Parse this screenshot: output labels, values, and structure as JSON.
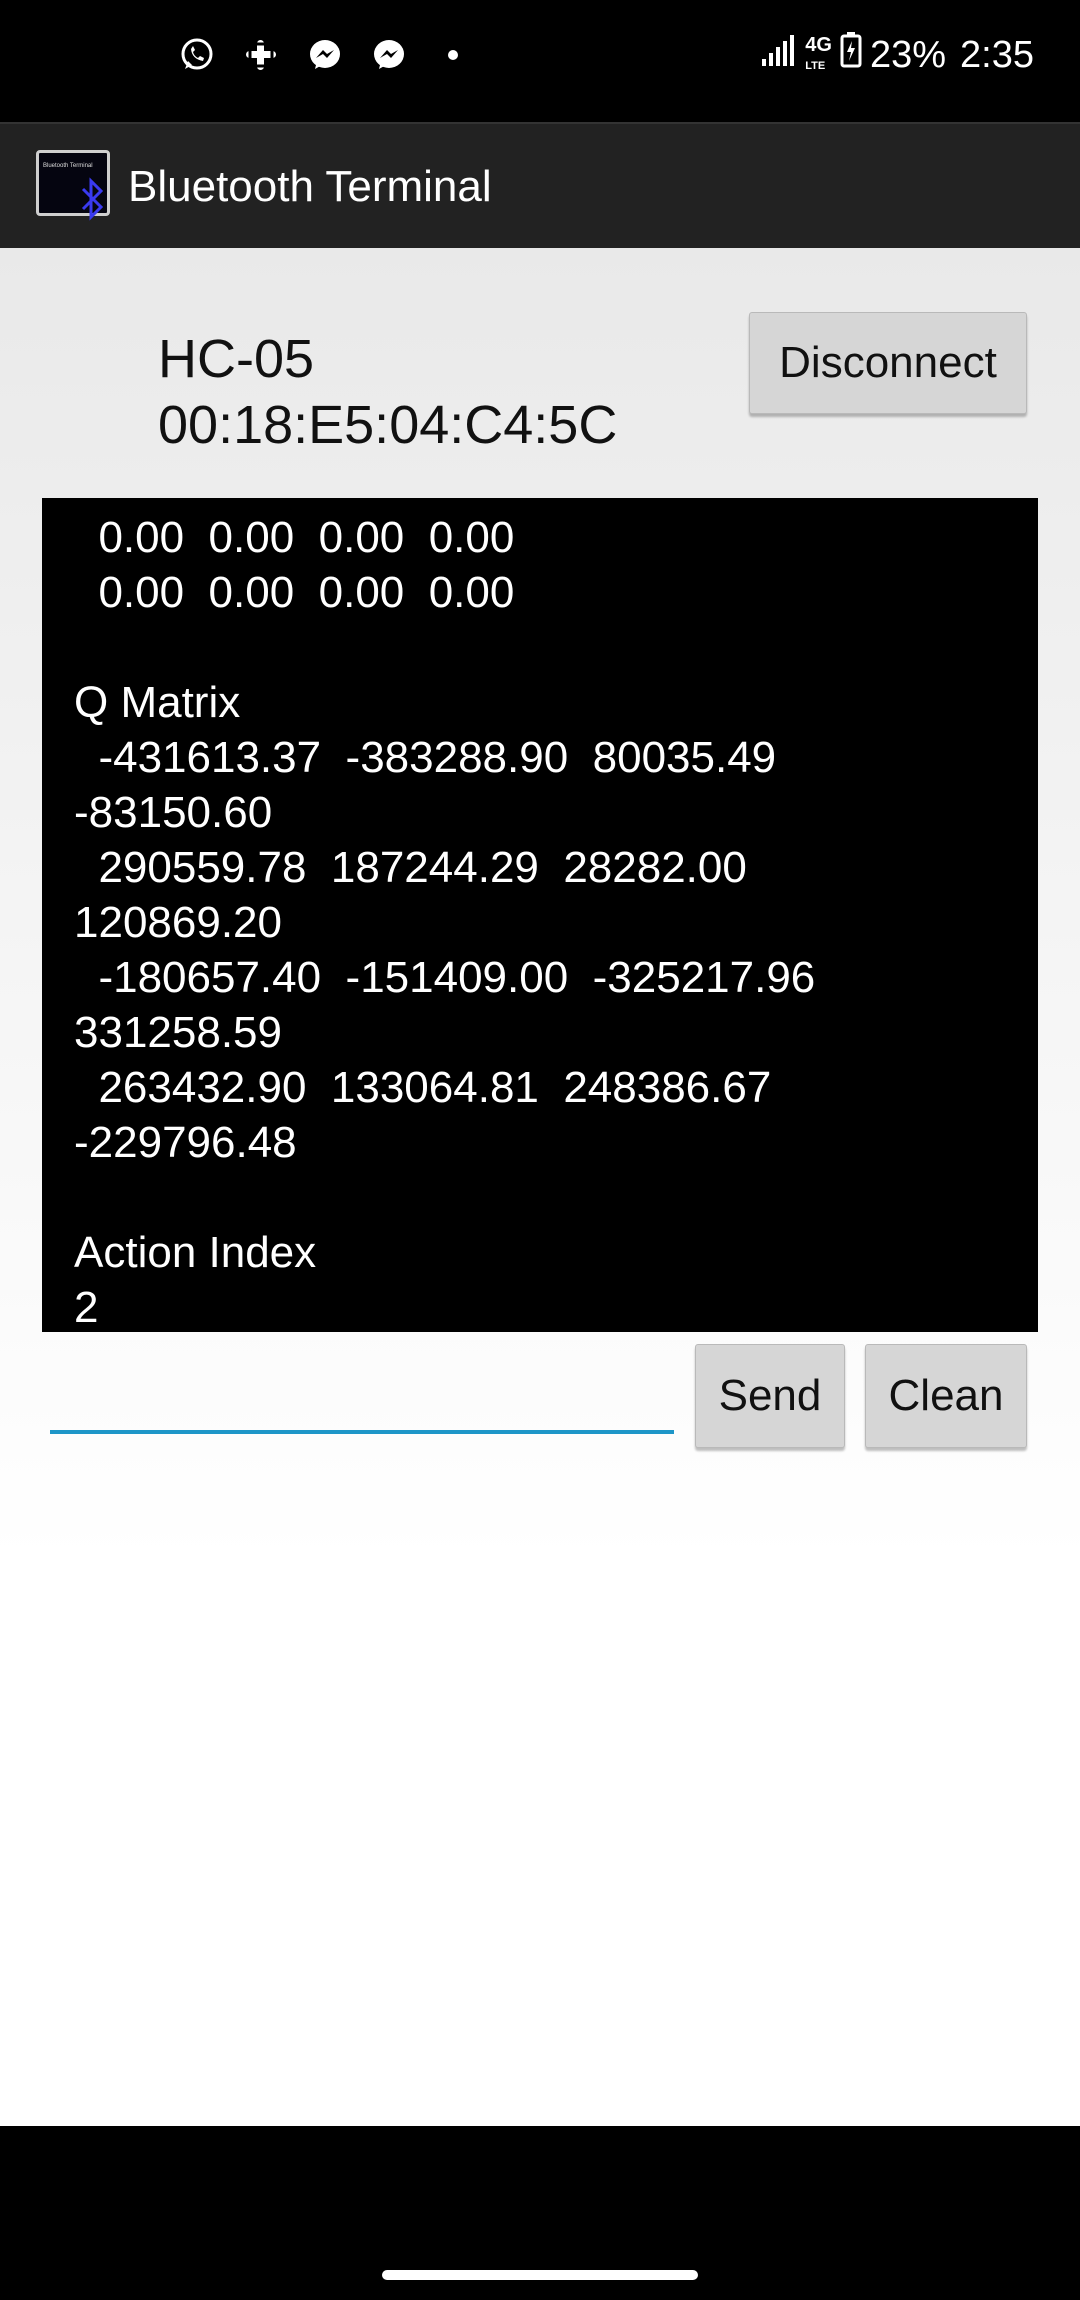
{
  "status_bar": {
    "notification_icons": [
      "whatsapp-icon",
      "slack-icon",
      "messenger-icon",
      "messenger-icon",
      "dot-icon"
    ],
    "network": "4G",
    "network_sub": "LTE",
    "battery": "23%",
    "time": "2:35"
  },
  "app_bar": {
    "title": "Bluetooth Terminal",
    "logo_text": "Bluetooth Terminal"
  },
  "device": {
    "name": "HC-05",
    "address": "00:18:E5:04:C4:5C"
  },
  "buttons": {
    "disconnect": "Disconnect",
    "send": "Send",
    "clean": "Clean"
  },
  "terminal": {
    "text": "  0.00  0.00  0.00  0.00\n  0.00  0.00  0.00  0.00\n\nQ Matrix\n  -431613.37  -383288.90  80035.49\n-83150.60\n  290559.78  187244.29  28282.00\n120869.20\n  -180657.40  -151409.00  -325217.96\n331258.59\n  263432.90  133064.81  248386.67\n-229796.48\n\nAction Index\n2"
  },
  "input": {
    "value": "",
    "placeholder": ""
  },
  "colors": {
    "input_underline": "#1e96c8",
    "bluetooth_blue": "#3a3af0",
    "app_bar": "#222222"
  }
}
